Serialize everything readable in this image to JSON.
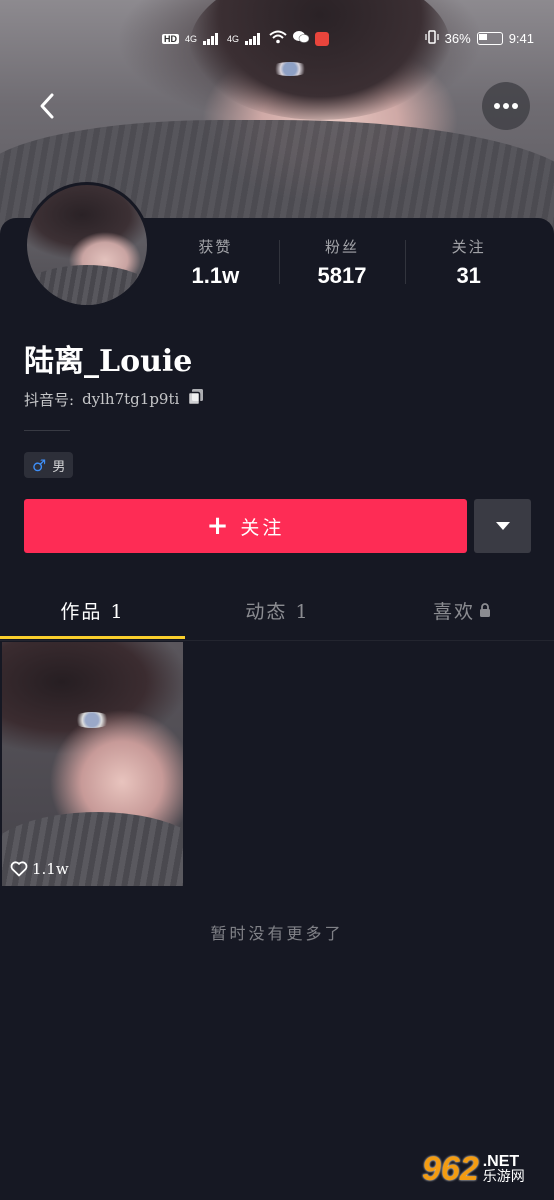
{
  "status_bar": {
    "network_hd1": "HD",
    "network_hd2": "HD",
    "sig1": "4G",
    "sig2": "4G",
    "battery_pct": "36%",
    "time": "9:41"
  },
  "profile": {
    "stats": [
      {
        "label": "获赞",
        "value": "1.1w"
      },
      {
        "label": "粉丝",
        "value": "5817"
      },
      {
        "label": "关注",
        "value": "31"
      }
    ],
    "name": "陆离_Louie",
    "uid_label": "抖音号:",
    "uid": "dylh7tg1p9ti",
    "gender": "男"
  },
  "actions": {
    "follow_label": "关注"
  },
  "tabs": [
    {
      "label": "作品 1"
    },
    {
      "label": "动态 1"
    },
    {
      "label": "喜欢"
    }
  ],
  "videos": [
    {
      "likes": "1.1w"
    }
  ],
  "footer": {
    "no_more": "暂时没有更多了"
  },
  "watermark": {
    "logo": "962",
    "net": ".NET",
    "cn": "乐游网"
  },
  "colors": {
    "background": "#161823",
    "follow_button": "#fe2c55",
    "tab_indicator": "#facf2c",
    "gender_symbol": "#3e8ef7"
  }
}
